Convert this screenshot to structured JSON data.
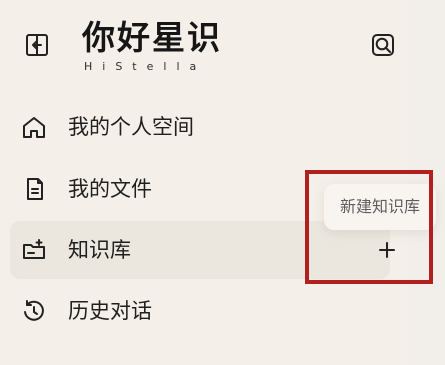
{
  "header": {
    "title": "你好星识",
    "subtitle": "HiStella",
    "collapse_icon": "sidebar-collapse-icon",
    "search_icon": "search-icon"
  },
  "sidebar": {
    "items": [
      {
        "label": "我的个人空间",
        "icon": "home-icon",
        "selected": false
      },
      {
        "label": "我的文件",
        "icon": "file-icon",
        "selected": false
      },
      {
        "label": "知识库",
        "icon": "folder-plus-icon",
        "selected": true,
        "action_icon": "add-icon"
      },
      {
        "label": "历史对话",
        "icon": "history-icon",
        "selected": false
      }
    ]
  },
  "tooltip": {
    "label": "新建知识库"
  },
  "colors": {
    "background": "#f6f2ec",
    "selected_item": "#ece7de",
    "highlight": "#b21f1f",
    "text": "#1f1f1f"
  }
}
